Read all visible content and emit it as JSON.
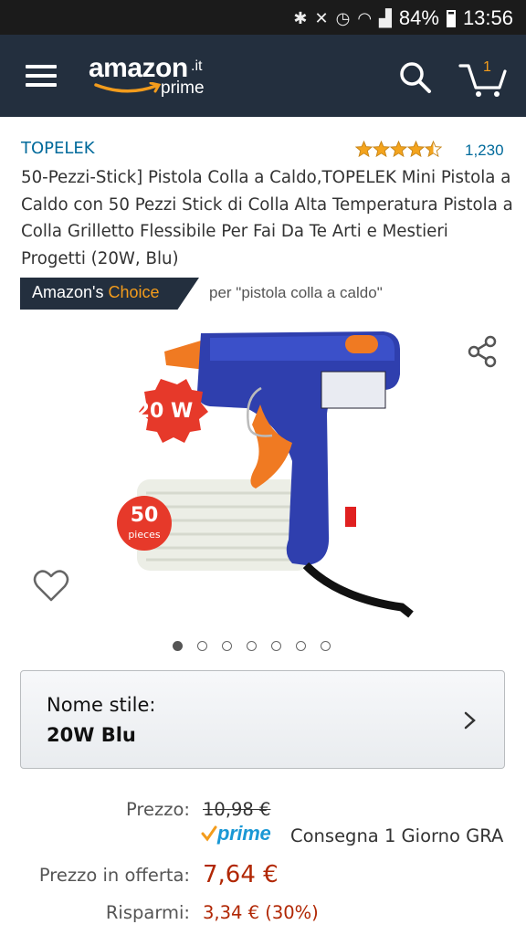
{
  "status_bar": {
    "battery": "84%",
    "time": "13:56"
  },
  "header": {
    "logo_text": "amazon",
    "logo_tld": ".it",
    "logo_prime": "prime",
    "cart_count": "1"
  },
  "product": {
    "brand": "TOPELEK",
    "rating_stars": 4.5,
    "rating_count": "1,230",
    "title": "50-Pezzi-Stick] Pistola Colla a Caldo,TOPELEK Mini Pistola a Caldo con 50 Pezzi Stick di Colla Alta Temperatura Pistola a Colla Grilletto Flessibile Per Fai Da Te Arti e Mestieri Progetti (20W, Blu)",
    "choice_prefix": "Amazon's ",
    "choice_word": "Choice",
    "choice_for": "per \"pistola colla a caldo\"",
    "image_badges": {
      "watt": "20 W",
      "count": "50",
      "count_unit": "pieces"
    },
    "image_count": 7,
    "active_image": 0
  },
  "style_selector": {
    "label": "Nome stile:",
    "value": "20W Blu"
  },
  "pricing": {
    "list_label": "Prezzo:",
    "list_price": "10,98 €",
    "prime_label": "prime",
    "delivery": "Consegna 1 Giorno GRA",
    "offer_label": "Prezzo in offerta:",
    "offer_price": "7,64 €",
    "savings_label": "Risparmi:",
    "savings_value": "3,34 € (30%)"
  },
  "colors": {
    "header_bg": "#232f3e",
    "link": "#006a9b",
    "price_red": "#b12704",
    "accent_orange": "#f39c1c",
    "prime_blue": "#1a98d5"
  }
}
